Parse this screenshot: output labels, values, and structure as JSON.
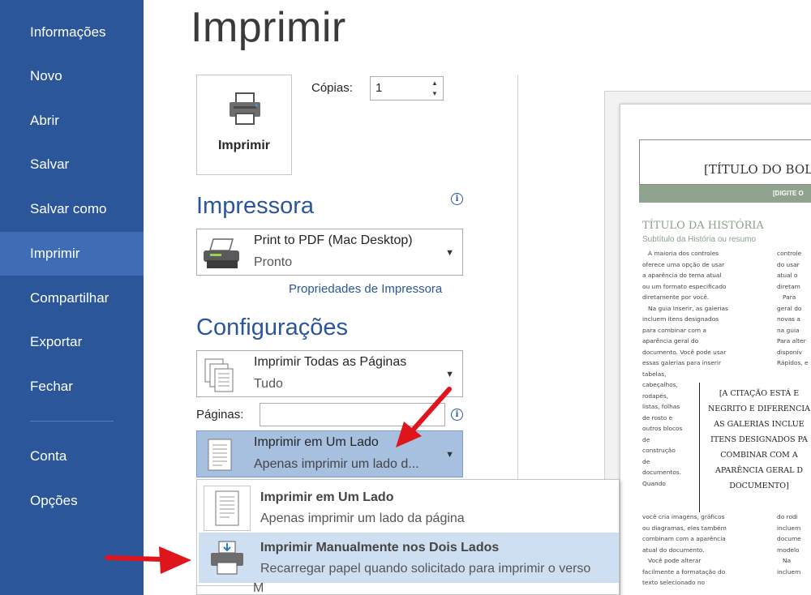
{
  "sidebar": {
    "items": [
      {
        "label": "Informações"
      },
      {
        "label": "Novo"
      },
      {
        "label": "Abrir"
      },
      {
        "label": "Salvar"
      },
      {
        "label": "Salvar como"
      },
      {
        "label": "Imprimir",
        "active": true
      },
      {
        "label": "Compartilhar"
      },
      {
        "label": "Exportar"
      },
      {
        "label": "Fechar"
      },
      {
        "label": "Conta"
      },
      {
        "label": "Opções"
      }
    ]
  },
  "page": {
    "title": "Imprimir"
  },
  "print_button": {
    "label": "Imprimir",
    "icon": "printer-icon"
  },
  "copies": {
    "label": "Cópias:",
    "value": "1"
  },
  "printer": {
    "heading": "Impressora",
    "name": "Print to PDF (Mac Desktop)",
    "status": "Pronto",
    "properties_link": "Propriedades de Impressora"
  },
  "settings": {
    "heading": "Configurações",
    "pages_range": {
      "main": "Imprimir Todas as Páginas",
      "sub": "Tudo"
    },
    "pages_label": "Páginas:",
    "pages_value": "",
    "sides": {
      "main": "Imprimir em Um Lado",
      "sub": "Apenas imprimir um lado d..."
    }
  },
  "sides_menu": {
    "options": [
      {
        "title": "Imprimir em Um Lado",
        "desc": "Apenas imprimir um lado da página"
      },
      {
        "title": "Imprimir Manualmente nos Dois Lados",
        "desc": "Recarregar papel quando solicitado para imprimir o verso",
        "highlighted": true
      }
    ],
    "partial_next": "M"
  },
  "preview": {
    "doc_title": "[TÍTULO DO BOL",
    "band_text": "[DIGITE O",
    "story_title": "TÍTULO DA HISTÓRIA",
    "story_subtitle": "Subtítulo da História ou resumo",
    "col1_top": "   A maioria dos controles\noferece uma opção de usar\na aparência do tema atual\nou um formato especificado\ndiretamente por você.\n   Na guia Inserir, as galerias\nincluem itens designados\npara combinar com a\naparência geral do\ndocumento. Você pode usar\nessas galerias para inserir\ntabelas,\ncabeçalhos,\nrodapés,\nlistas, folhas\nde rosto e\noutros blocos\nde\nconstrução\nde\ndocumentos.\nQuando",
    "col1_bottom": "você cria imagens, gráficos\nou diagramas, eles também\ncombinam com a aparência\natual do documento.\n   Você pode alterar\nfacilmente a formatação do\ntexto selecionado no",
    "col2_top": "controle\ndo usar\natual o\ndiretam\n   Para\ngeral do\nnovas a\nna guia\nPara alter\ndisponív\nRápidos, e",
    "col2_bottom": "do rodi\nincluem\ndocume\nmodelo\n   Na\nincluem",
    "quote": "[A CITAÇÃO ESTÁ E\nNEGRITO E DIFERENCIA\nAS GALERIAS INCLUE\nITENS DESIGNADOS PA\nCOMBINAR COM A\nAPARÊNCIA GERAL D\nDOCUMENTO]"
  },
  "colors": {
    "sidebar": "#2b579a",
    "active_nav": "#3e6db5",
    "accent": "#2b579a",
    "arrow": "#e0141b",
    "highlight": "#cfdff2"
  }
}
